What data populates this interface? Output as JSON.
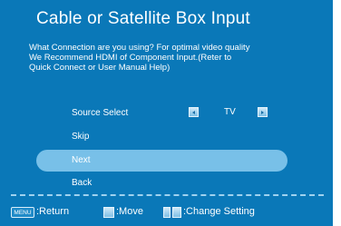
{
  "screen": {
    "title": "Cable or Satellite Box Input",
    "description_lines": [
      "What Connection are you using? For optimal video quality",
      "We Recommend HDMI of Component Input.(Reter to",
      "Quick Connect or User Manual Help)"
    ]
  },
  "menu": {
    "items": [
      {
        "label": "Source Select",
        "value": "TV"
      },
      {
        "label": "Skip"
      },
      {
        "label": "Next",
        "selected": true
      },
      {
        "label": "Back"
      }
    ]
  },
  "footer": {
    "menu_key": "MENU",
    "return_label": ":Return",
    "move_label": ":Move",
    "change_label": ":Change Setting"
  },
  "colors": {
    "background": "#0a78b8",
    "highlight": "#78c0e8",
    "text": "#ffffff"
  },
  "icons": {
    "left_arrow": "left-arrow-icon",
    "right_arrow": "right-arrow-icon",
    "move_keys": "up-down-keys-icon",
    "change_keys": "left-right-keys-icon"
  }
}
